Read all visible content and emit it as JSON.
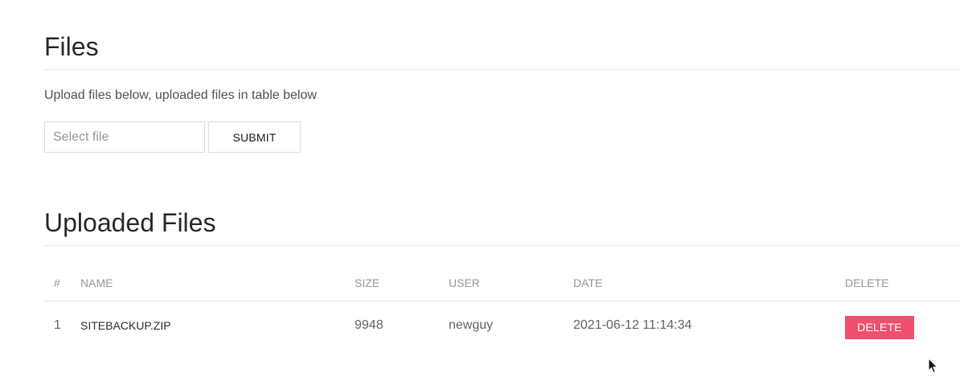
{
  "files_section": {
    "title": "Files",
    "subtitle": "Upload files below, uploaded files in table below"
  },
  "upload_form": {
    "file_placeholder": "Select file",
    "submit_label": "SUBMIT"
  },
  "uploaded_section": {
    "title": "Uploaded Files"
  },
  "table": {
    "headers": {
      "num": "#",
      "name": "NAME",
      "size": "SIZE",
      "user": "USER",
      "date": "DATE",
      "delete": "DELETE"
    },
    "rows": [
      {
        "num": "1",
        "name": "SITEBACKUP.ZIP",
        "size": "9948",
        "user": "newguy",
        "date": "2021-06-12 11:14:34",
        "delete_label": "DELETE"
      }
    ]
  },
  "colors": {
    "delete_button": "#f0506e",
    "rule": "#e6e6e6"
  },
  "icons": {
    "cursor": "mouse-pointer-icon"
  }
}
